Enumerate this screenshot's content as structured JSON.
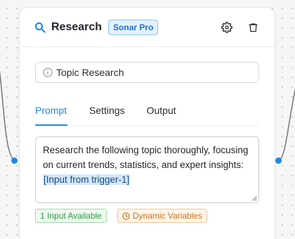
{
  "node": {
    "title": "Research",
    "model_badge": "Sonar Pro",
    "name_field": {
      "value": "Topic Research"
    },
    "tabs": [
      {
        "label": "Prompt",
        "active": true
      },
      {
        "label": "Settings",
        "active": false
      },
      {
        "label": "Output",
        "active": false
      }
    ],
    "prompt": {
      "text": "Research the following topic thoroughly, focusing on current trends, statistics, and expert insights: ",
      "variable": "[Input from trigger-1]"
    },
    "chips": {
      "inputs": "1 Input Available",
      "dynamic": "Dynamic Variables"
    }
  },
  "colors": {
    "accent": "#1e88e5",
    "badge_bg": "#e4f1fc",
    "success": "#2e9a47",
    "warning": "#c9741b"
  },
  "icons": [
    "search-icon",
    "gear-icon",
    "trash-icon",
    "info-icon",
    "clock-icon",
    "resize-handle-icon"
  ]
}
